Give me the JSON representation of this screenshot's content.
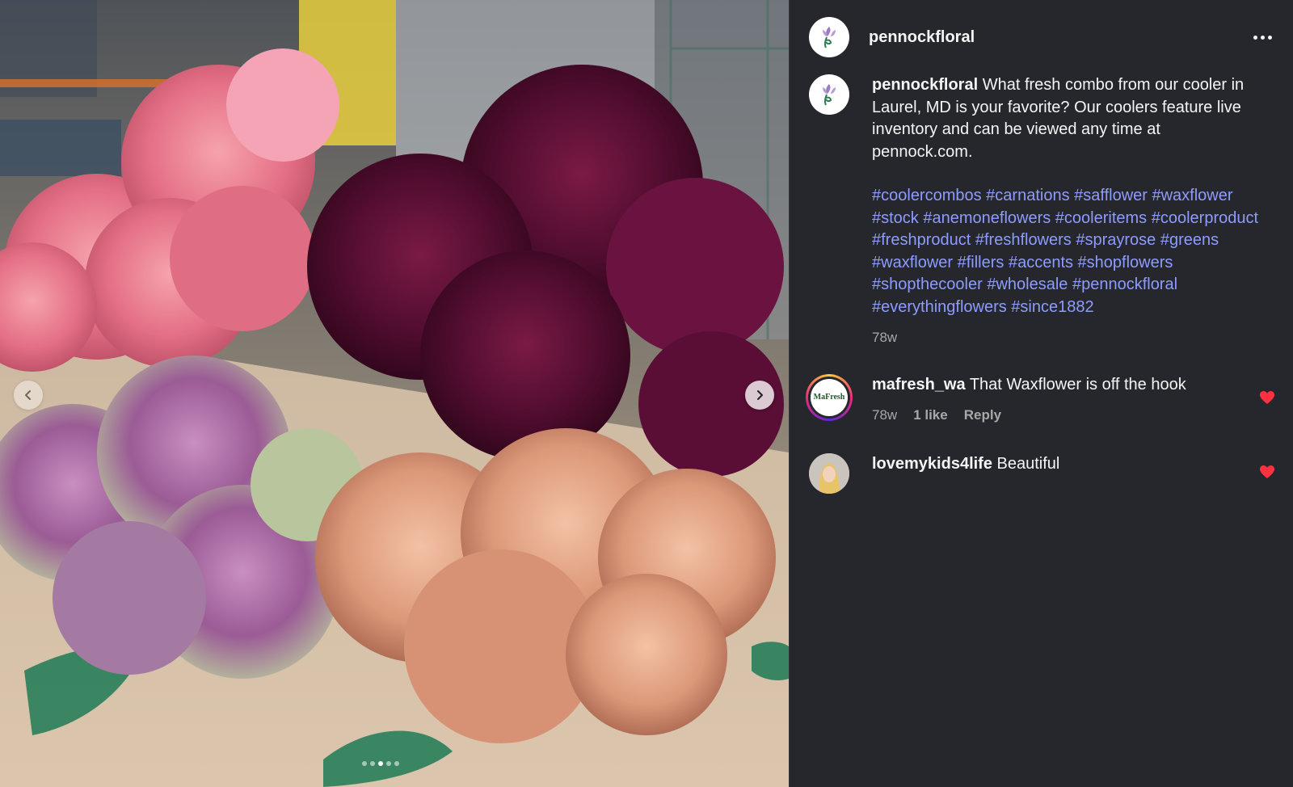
{
  "post": {
    "username": "pennockfloral",
    "caption": {
      "username": "pennockfloral",
      "text": "What fresh combo from our cooler in Laurel, MD is your favorite? Our coolers feature live inventory and can be viewed any time at pennock.com.",
      "hashtags": "#coolercombos #carnations #safflower #waxflower #stock #anemoneflowers #cooleritems #coolerproduct #freshproduct #freshflowers #sprayrose #greens #waxflower #fillers #accents #shopflowers #shopthecooler #wholesale #pennockfloral #everythingflowers #since1882",
      "time": "78w"
    },
    "photo": {
      "subject": "carnation bouquets",
      "dots_total": 5,
      "active_dot": 3
    }
  },
  "comments": [
    {
      "username": "mafresh_wa",
      "avatar_label": "MaFresh",
      "text": "That Waxflower is off the hook",
      "time": "78w",
      "likes": "1 like",
      "reply": "Reply"
    },
    {
      "username": "lovemykids4life",
      "text": "Beautiful"
    }
  ],
  "icons": {
    "more": "more-options-icon",
    "prev": "chevron-left-icon",
    "next": "chevron-right-icon",
    "heart": "heart-icon"
  },
  "colors": {
    "panel_bg": "#25272d",
    "hashtag": "#8e9bff",
    "heart": "#ff3040",
    "muted": "#a8a8a8"
  }
}
